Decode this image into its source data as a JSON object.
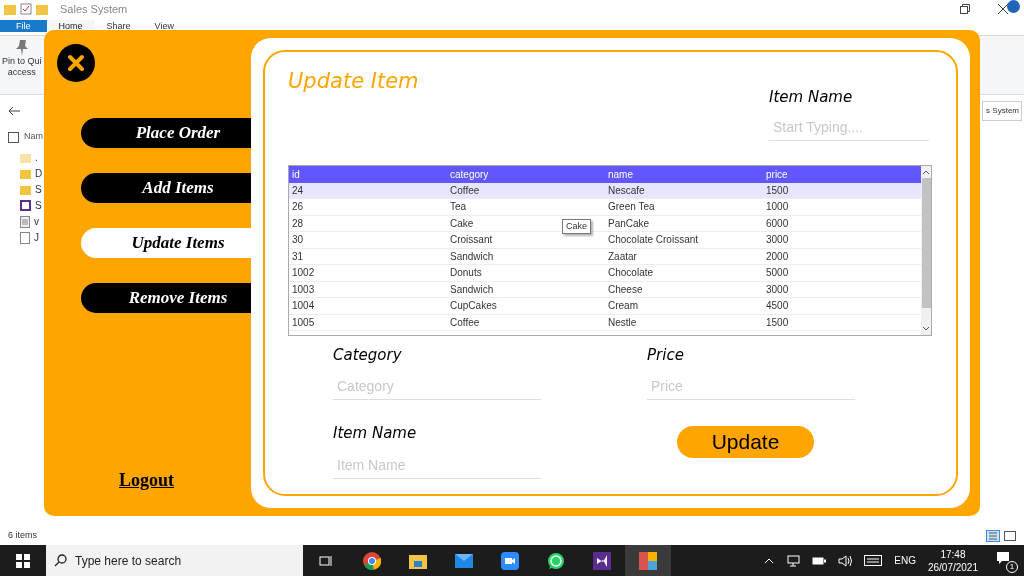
{
  "explorer": {
    "title": "Sales System",
    "ribbon_tabs": [
      {
        "label": "File",
        "selected": false,
        "kind": "file"
      },
      {
        "label": "Home",
        "selected": true,
        "kind": "tab"
      },
      {
        "label": "Share",
        "selected": false,
        "kind": "tab"
      },
      {
        "label": "View",
        "selected": false,
        "kind": "tab"
      }
    ],
    "pin_label": [
      "Pin to Qui",
      "access"
    ],
    "column_header": "Nam",
    "select_all_checked": false,
    "search_text": "s System",
    "files": [
      {
        "name": ".",
        "kind": "hidden"
      },
      {
        "name": "D",
        "kind": "folder"
      },
      {
        "name": "S",
        "kind": "folder"
      },
      {
        "name": "S",
        "kind": "solution"
      },
      {
        "name": "v",
        "kind": "doc"
      },
      {
        "name": "J",
        "kind": "file"
      }
    ],
    "status": "6 items"
  },
  "app": {
    "nav": [
      {
        "label": "Place Order",
        "selected": false
      },
      {
        "label": "Add Items",
        "selected": false
      },
      {
        "label": "Update Items",
        "selected": true
      },
      {
        "label": "Remove Items",
        "selected": false
      }
    ],
    "logout": "Logout",
    "title": "Update Item",
    "item_name_label": "Item Name",
    "search_placeholder": "Start Typing....",
    "table": {
      "columns": [
        "id",
        "category",
        "name",
        "price"
      ],
      "rows": [
        {
          "cells": [
            "24",
            "Coffee",
            "Nescafe",
            "1500"
          ],
          "selected": true
        },
        {
          "cells": [
            "26",
            "Tea",
            "Green Tea",
            "1000"
          ],
          "selected": false
        },
        {
          "cells": [
            "28",
            "Cake",
            "PanCake",
            "6000"
          ],
          "selected": false
        },
        {
          "cells": [
            "30",
            "Croissant",
            "Chocolate Croissant",
            "3000"
          ],
          "selected": false
        },
        {
          "cells": [
            "31",
            "Sandwich",
            "Zaatar",
            "2000"
          ],
          "selected": false
        },
        {
          "cells": [
            "1002",
            "Donuts",
            "Chocolate",
            "5000"
          ],
          "selected": false
        },
        {
          "cells": [
            "1003",
            "Sandwich",
            "Cheese",
            "3000"
          ],
          "selected": false
        },
        {
          "cells": [
            "1004",
            "CupCakes",
            "Cream",
            "4500"
          ],
          "selected": false
        },
        {
          "cells": [
            "1005",
            "Coffee",
            "Nestle",
            "1500"
          ],
          "selected": false
        }
      ]
    },
    "tooltip": "Cake",
    "fields": [
      {
        "label": "Category",
        "placeholder": "Category"
      },
      {
        "label": "Price",
        "placeholder": "Price"
      },
      {
        "label": "Item Name",
        "placeholder": "Item Name"
      }
    ],
    "update_button": "Update"
  },
  "taskbar": {
    "search_placeholder": "Type here to search",
    "language": "ENG",
    "time": "17:48",
    "date": "26/07/2021",
    "notification_count": "1"
  }
}
